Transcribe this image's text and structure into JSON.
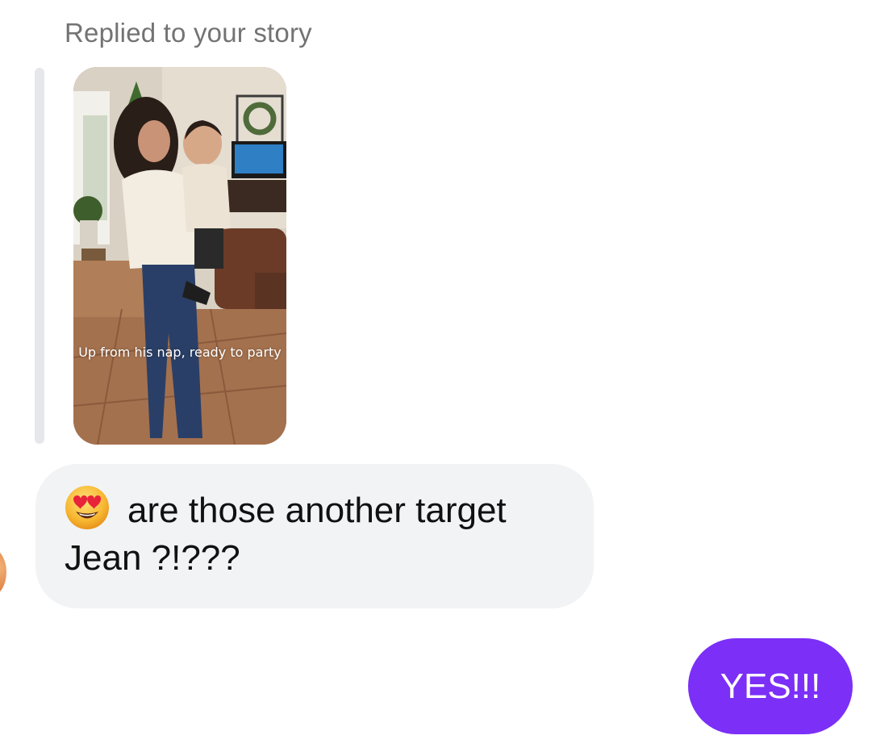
{
  "thread": {
    "reply_caption": "Replied to your story",
    "story": {
      "image_label": "story-photo-woman-holding-toddler-living-room",
      "overlay_text": "Up from his nap, ready to party"
    },
    "incoming_message": {
      "emoji": "smiling-face-with-heart-eyes",
      "line1": "are those another target",
      "line2": "Jean ?!???"
    },
    "outgoing_message": {
      "text": "YES!!!"
    }
  },
  "colors": {
    "incoming_bubble": "#f2f3f5",
    "outgoing_bubble": "#7b2ff7",
    "caption_text": "#737373",
    "reply_bar": "#e6e7ea"
  }
}
